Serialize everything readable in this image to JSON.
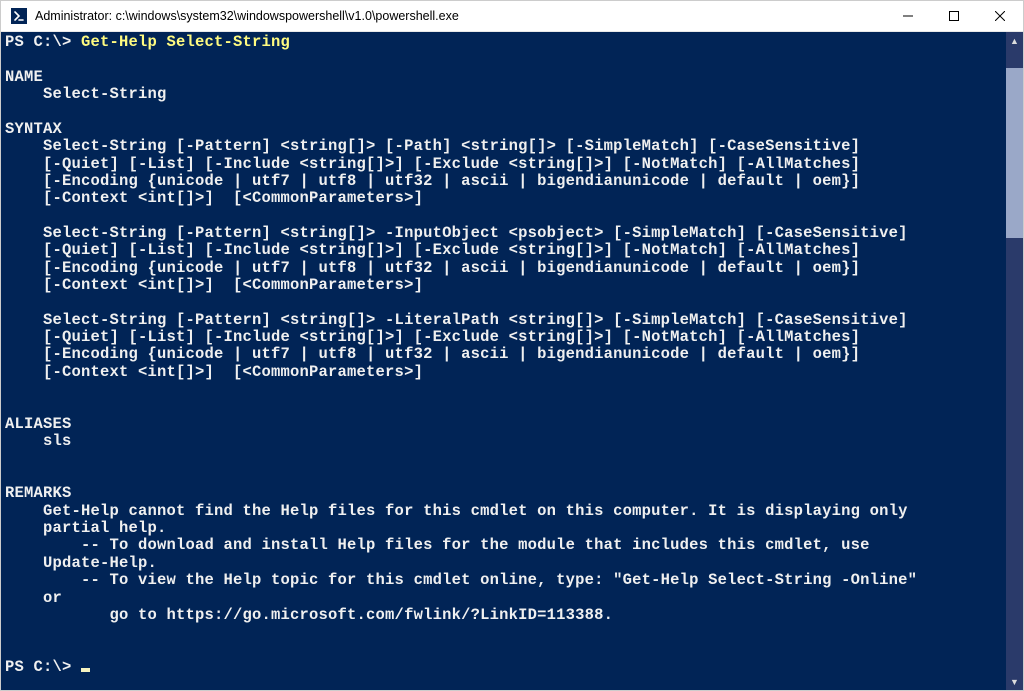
{
  "titlebar": {
    "title": "Administrator: c:\\windows\\system32\\windowspowershell\\v1.0\\powershell.exe"
  },
  "prompt1": {
    "ps": "PS C:\\> ",
    "cmd": "Get-Help Select-String"
  },
  "help": {
    "name_header": "NAME",
    "name_value": "    Select-String",
    "syntax_header": "SYNTAX",
    "syntax_block1_l1": "    Select-String [-Pattern] <string[]> [-Path] <string[]> [-SimpleMatch] [-CaseSensitive]",
    "syntax_block1_l2": "    [-Quiet] [-List] [-Include <string[]>] [-Exclude <string[]>] [-NotMatch] [-AllMatches]",
    "syntax_block1_l3": "    [-Encoding {unicode | utf7 | utf8 | utf32 | ascii | bigendianunicode | default | oem}]",
    "syntax_block1_l4": "    [-Context <int[]>]  [<CommonParameters>]",
    "syntax_block2_l1": "    Select-String [-Pattern] <string[]> -InputObject <psobject> [-SimpleMatch] [-CaseSensitive]",
    "syntax_block2_l2": "    [-Quiet] [-List] [-Include <string[]>] [-Exclude <string[]>] [-NotMatch] [-AllMatches]",
    "syntax_block2_l3": "    [-Encoding {unicode | utf7 | utf8 | utf32 | ascii | bigendianunicode | default | oem}]",
    "syntax_block2_l4": "    [-Context <int[]>]  [<CommonParameters>]",
    "syntax_block3_l1": "    Select-String [-Pattern] <string[]> -LiteralPath <string[]> [-SimpleMatch] [-CaseSensitive]",
    "syntax_block3_l2": "    [-Quiet] [-List] [-Include <string[]>] [-Exclude <string[]>] [-NotMatch] [-AllMatches]",
    "syntax_block3_l3": "    [-Encoding {unicode | utf7 | utf8 | utf32 | ascii | bigendianunicode | default | oem}]",
    "syntax_block3_l4": "    [-Context <int[]>]  [<CommonParameters>]",
    "aliases_header": "ALIASES",
    "aliases_value": "    sls",
    "remarks_header": "REMARKS",
    "remarks_l1": "    Get-Help cannot find the Help files for this cmdlet on this computer. It is displaying only",
    "remarks_l2": "    partial help.",
    "remarks_l3": "        -- To download and install Help files for the module that includes this cmdlet, use",
    "remarks_l4": "    Update-Help.",
    "remarks_l5": "        -- To view the Help topic for this cmdlet online, type: \"Get-Help Select-String -Online\"",
    "remarks_l6": "    or",
    "remarks_l7": "           go to https://go.microsoft.com/fwlink/?LinkID=113388."
  },
  "prompt2": {
    "ps": "PS C:\\> "
  }
}
